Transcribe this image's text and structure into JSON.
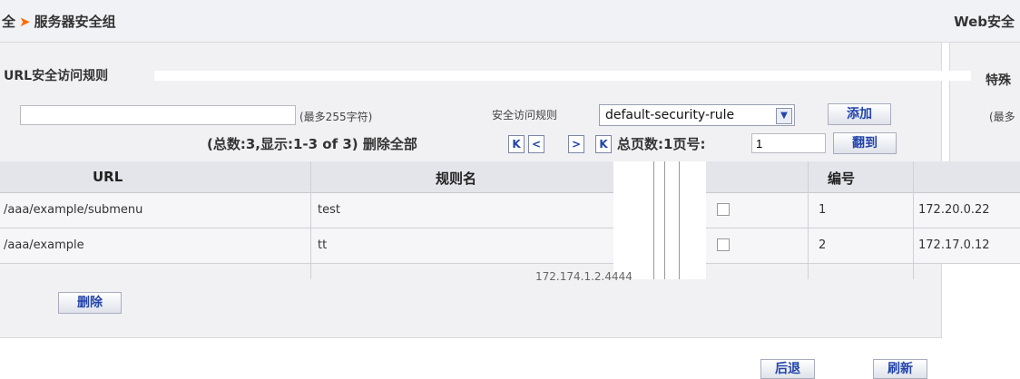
{
  "header": {
    "breadcrumb_prefix": "全",
    "breadcrumb": "服务器安全组",
    "right_title": "Web安全"
  },
  "rule_section": {
    "title": "URL安全访问规则",
    "right_label": "特殊",
    "name_hint": "(最多255字符)",
    "security_rule_label": "安全访问规则",
    "select_value": "default-security-rule",
    "add_button": "添加",
    "right_hint": "(最多"
  },
  "pager": {
    "summary": "(总数:3,显示:1-3 of 3)",
    "delete_all": "删除全部",
    "total_pages": "总页数:1",
    "page_no_label": "页号:",
    "page_no_value": "1",
    "goto_button": "翻到"
  },
  "table": {
    "headers": [
      "URL",
      "规则名",
      "编号"
    ],
    "rows": [
      {
        "url": "/aaa/example/submenu",
        "rule": "test",
        "id": "1",
        "ip": "172.20.0.22"
      },
      {
        "url": "/aaa/example",
        "rule": "tt",
        "id": "2",
        "ip": "172.17.0.12"
      }
    ],
    "glitch_text": "172.174.1.2.4444"
  },
  "actions": {
    "delete_button": "删除",
    "back_button": "后退",
    "refresh_button": "刷新"
  }
}
